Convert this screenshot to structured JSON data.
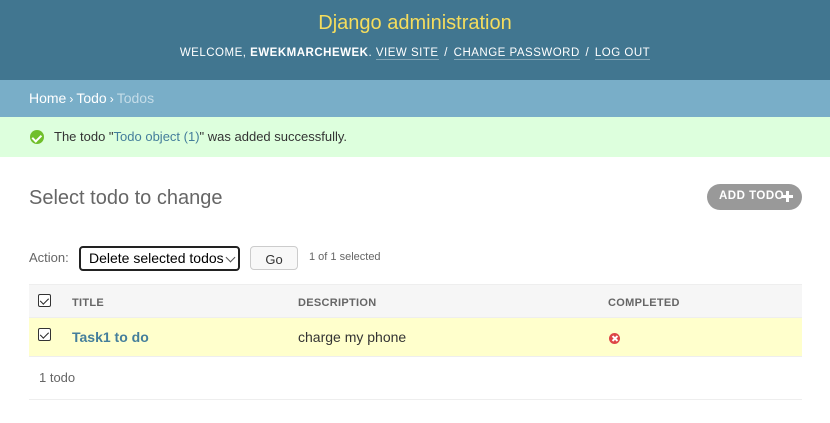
{
  "header": {
    "site_name": "Django administration",
    "welcome": "WELCOME,",
    "username": "EWEKMARCHEWEK",
    "period": ".",
    "links": {
      "view_site": "VIEW SITE",
      "change_password": "CHANGE PASSWORD",
      "log_out": "LOG OUT"
    },
    "separator": "/"
  },
  "breadcrumbs": {
    "home": "Home",
    "app": "Todo",
    "current": "Todos",
    "separator": "›"
  },
  "message": {
    "icon": "success-check-icon",
    "prefix": "The todo \"",
    "link": "Todo object (1)",
    "suffix": "\" was added successfully."
  },
  "content": {
    "title": "Select todo to change",
    "add_button": "ADD TODO"
  },
  "actions": {
    "label": "Action:",
    "selected_option": "Delete selected todos",
    "go_button": "Go",
    "selection_count": "1 of 1 selected"
  },
  "table": {
    "columns": [
      "TITLE",
      "DESCRIPTION",
      "COMPLETED"
    ],
    "rows": [
      {
        "selected": true,
        "title": "Task1 to do",
        "description": "charge my phone",
        "completed": false,
        "completed_icon": "no-icon"
      }
    ]
  },
  "paginator": {
    "count": "1 todo"
  },
  "colors": {
    "header_bg": "#417690",
    "site_name": "#f5dd5d",
    "breadcrumbs_bg": "#79aec8",
    "message_bg": "#dddddd",
    "selected_row_bg": "#ffffcc",
    "link": "#447e9b"
  }
}
